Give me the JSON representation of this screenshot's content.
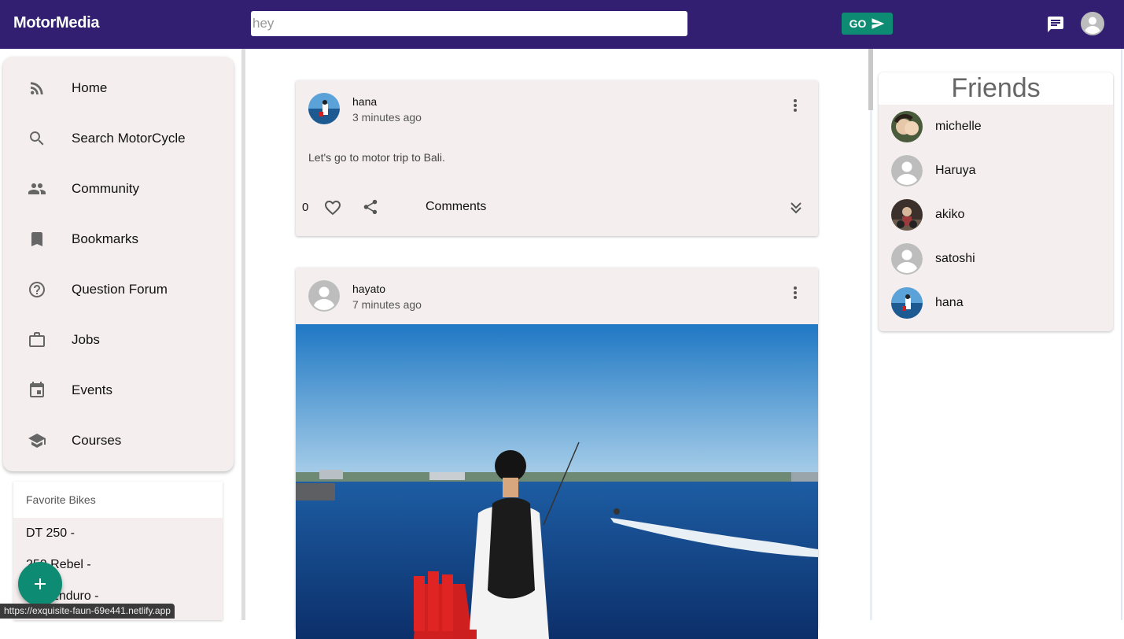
{
  "app": {
    "title": "MotorMedia"
  },
  "search": {
    "value": "hey",
    "go_label": "GO"
  },
  "nav": {
    "items": [
      {
        "label": "Home",
        "icon": "rss-feed-icon"
      },
      {
        "label": "Search MotorCycle",
        "icon": "search-icon"
      },
      {
        "label": "Community",
        "icon": "people-icon"
      },
      {
        "label": "Bookmarks",
        "icon": "bookmark-icon"
      },
      {
        "label": "Question Forum",
        "icon": "help-circle-icon"
      },
      {
        "label": "Jobs",
        "icon": "briefcase-icon"
      },
      {
        "label": "Events",
        "icon": "calendar-icon"
      },
      {
        "label": "Courses",
        "icon": "school-icon"
      }
    ]
  },
  "favorites": {
    "title": "Favorite Bikes",
    "items": [
      "DT 250 -",
      "250 Rebel -",
      "250 Enduro -"
    ]
  },
  "status_url": "https://exquisite-faun-69e441.netlify.app",
  "posts": [
    {
      "author": "hana",
      "time": "3 minutes ago",
      "text": "Let's go to motor trip to Bali.",
      "likes": "0",
      "comments_label": "Comments"
    },
    {
      "author": "hayato",
      "time": "7 minutes ago"
    }
  ],
  "friends": {
    "title": "Friends",
    "list": [
      "michelle",
      "Haruya",
      "akiko",
      "satoshi",
      "hana"
    ]
  },
  "colors": {
    "topbar": "#321f72",
    "accent": "#0e8c73",
    "card": "#f4eeee"
  }
}
